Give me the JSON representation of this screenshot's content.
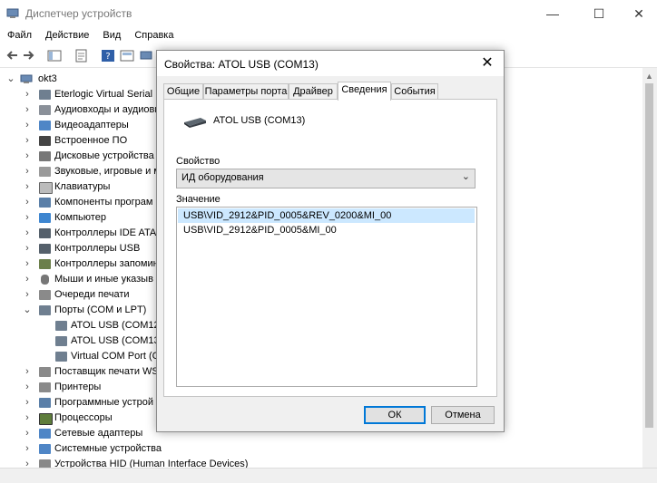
{
  "window": {
    "title": "Диспетчер устройств",
    "controls": {
      "minimize": "—",
      "maximize": "☐",
      "close": "✕"
    }
  },
  "menu": [
    "Файл",
    "Действие",
    "Вид",
    "Справка"
  ],
  "tree": {
    "root": "okt3",
    "items": [
      "Eterlogic Virtual Serial P",
      "Аудиовходы и аудиовыход",
      "Видеоадаптеры",
      "Встроенное ПО",
      "Дисковые устройства",
      "Звуковые, игровые и м",
      "Клавиатуры",
      "Компоненты програм",
      "Компьютер",
      "Контроллеры IDE ATA/",
      "Контроллеры USB",
      "Контроллеры запомин",
      "Мыши и иные указыв",
      "Очереди печати",
      "Порты (COM и LPT)",
      "ATOL USB (COM12)",
      "ATOL USB (COM13)",
      "Virtual COM Port (C",
      "Поставщик печати WS",
      "Принтеры",
      "Программные устрой",
      "Процессоры",
      "Сетевые адаптеры",
      "Системные устройства",
      "Устройства HID (Human Interface Devices)"
    ]
  },
  "dialog": {
    "title": "Свойства: ATOL USB (COM13)",
    "close": "✕",
    "tabs": [
      "Общие",
      "Параметры порта",
      "Драйвер",
      "Сведения",
      "События"
    ],
    "device_name": "ATOL USB (COM13)",
    "property_label": "Свойство",
    "property_value": "ИД оборудования",
    "value_label": "Значение",
    "values": [
      "USB\\VID_2912&PID_0005&REV_0200&MI_00",
      "USB\\VID_2912&PID_0005&MI_00"
    ],
    "ok": "ОК",
    "cancel": "Отмена"
  },
  "colors": {
    "accent": "#0078d7",
    "selection": "#cce8ff"
  }
}
